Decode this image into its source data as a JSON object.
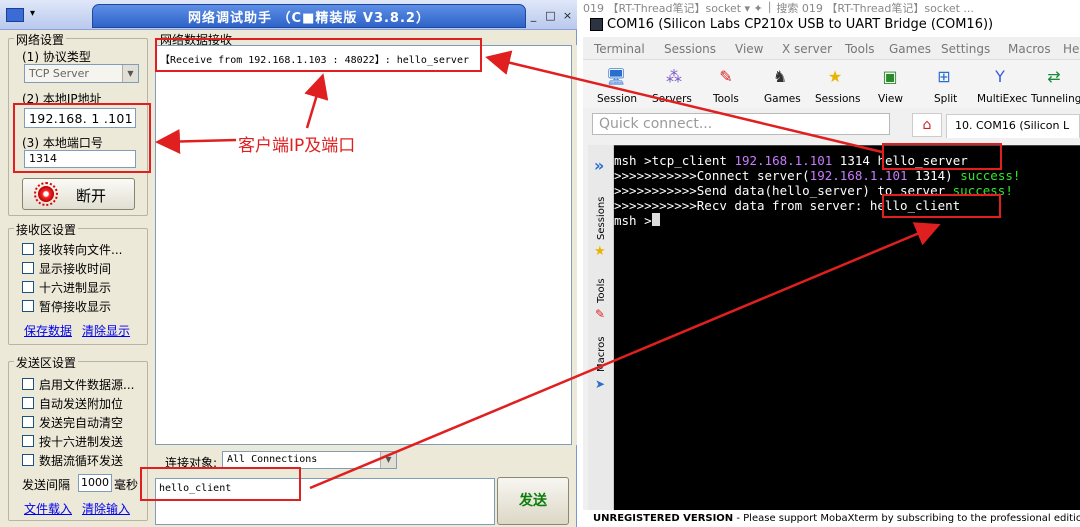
{
  "netassist": {
    "title": "网络调试助手 （C■精装版 V3.8.2）",
    "sys_menu": "▾",
    "window_buttons": [
      "_",
      "□",
      "×"
    ],
    "net_settings": {
      "group_label": "网络设置",
      "protocol_label": "(1) 协议类型",
      "protocol_value": "TCP Server",
      "local_ip_label": "(2) 本地IP地址",
      "local_ip_value": "192.168. 1 .101",
      "local_port_label": "(3) 本地端口号",
      "local_port_value": "1314",
      "connect_button": "断开"
    },
    "recv_settings": {
      "group_label": "接收区设置",
      "options": [
        "接收转向文件...",
        "显示接收时间",
        "十六进制显示",
        "暂停接收显示"
      ],
      "save_link": "保存数据",
      "clear_link": "清除显示"
    },
    "send_settings": {
      "group_label": "发送区设置",
      "options": [
        "启用文件数据源...",
        "自动发送附加位",
        "发送完自动清空",
        "按十六进制发送",
        "数据流循环发送"
      ],
      "interval_label": "发送间隔",
      "interval_value": "1000",
      "interval_unit": "毫秒",
      "load_link": "文件载入",
      "clear_link": "清除输入"
    },
    "recv_area": {
      "label": "网络数据接收",
      "line": "【Receive from 192.168.1.103 : 48022】: hello_server"
    },
    "connect_target": {
      "label": "连接对象:",
      "value": "All Connections"
    },
    "send_area": {
      "text": "hello_client",
      "button": "发送"
    }
  },
  "annotation": {
    "label": "客户端IP及端口",
    "color": "#e02020"
  },
  "mobaxterm": {
    "background_tab_text": "019 【RT-Thread笔记】socket     ▾  ✦  │  搜索 019 【RT-Thread笔记】socket ...",
    "title": "COM16  (Silicon Labs CP210x USB to UART Bridge (COM16))",
    "menu": [
      "Terminal",
      "Sessions",
      "View",
      "X server",
      "Tools",
      "Games",
      "Settings",
      "Macros",
      "He"
    ],
    "toolbar": [
      {
        "label": "Session",
        "icon": "session-icon"
      },
      {
        "label": "Servers",
        "icon": "servers-icon"
      },
      {
        "label": "Tools",
        "icon": "tools-icon"
      },
      {
        "label": "Games",
        "icon": "games-icon"
      },
      {
        "label": "Sessions",
        "icon": "sessions-star-icon"
      },
      {
        "label": "View",
        "icon": "view-icon"
      },
      {
        "label": "Split",
        "icon": "split-icon"
      },
      {
        "label": "MultiExec",
        "icon": "multiexec-icon"
      },
      {
        "label": "Tunneling",
        "icon": "tunneling-icon"
      }
    ],
    "quick_connect_placeholder": "Quick connect...",
    "session_tab": "10. COM16 (Silicon L",
    "side_labels": [
      "Sessions",
      "Tools",
      "Macros"
    ],
    "terminal": {
      "line1": {
        "prompt": "msh >",
        "cmd": "tcp_client ",
        "ip": "192.168.1.101",
        "port": " 1314 ",
        "arg": "hello_server"
      },
      "line2": {
        "prefix": ">>>>>>>>>>>Connect server(",
        "ip": "192.168.1.101",
        "mid": " 1314) ",
        "status": "success!"
      },
      "line3": {
        "prefix": ">>>>>>>>>>>Send data(hello_server) to server ",
        "status": "success!"
      },
      "line4": {
        "prefix": ">>>>>>>>>>>Recv data from server: ",
        "arg": "hello_client"
      },
      "line5": {
        "prompt": "msh >"
      },
      "colors": {
        "ip": "#c77cff",
        "status": "#2ee62e",
        "text": "#ffffff"
      }
    },
    "status_bar": {
      "bold": "UNREGISTERED VERSION",
      "text": " -  Please support MobaXterm by subscribing to the professional edition here"
    }
  }
}
